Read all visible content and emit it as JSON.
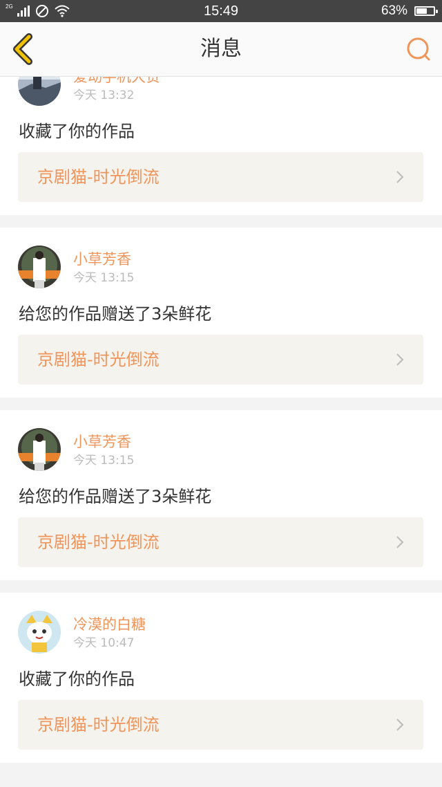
{
  "status_bar": {
    "network": "2G",
    "time": "15:49",
    "battery": "63%",
    "battery_level": 0.63
  },
  "header": {
    "title": "消息",
    "back_icon": "chevron-left-icon",
    "search_icon": "search-icon"
  },
  "colors": {
    "accent": "#f0955a",
    "back_chevron": "#f2c200",
    "card_bg": "#ffffff",
    "work_bg": "#f4f3ee",
    "page_bg": "#f3f3f3"
  },
  "messages": [
    {
      "user": "爱动手机大赞",
      "time": "今天 13:32",
      "action": "收藏了你的作品",
      "work": "京剧猫-时光倒流"
    },
    {
      "user": "小草芳香",
      "time": "今天 13:15",
      "action": "给您的作品赠送了3朵鲜花",
      "work": "京剧猫-时光倒流"
    },
    {
      "user": "小草芳香",
      "time": "今天 13:15",
      "action": "给您的作品赠送了3朵鲜花",
      "work": "京剧猫-时光倒流"
    },
    {
      "user": "冷漠的白糖",
      "time": "今天 10:47",
      "action": "收藏了你的作品",
      "work": "京剧猫-时光倒流"
    }
  ]
}
